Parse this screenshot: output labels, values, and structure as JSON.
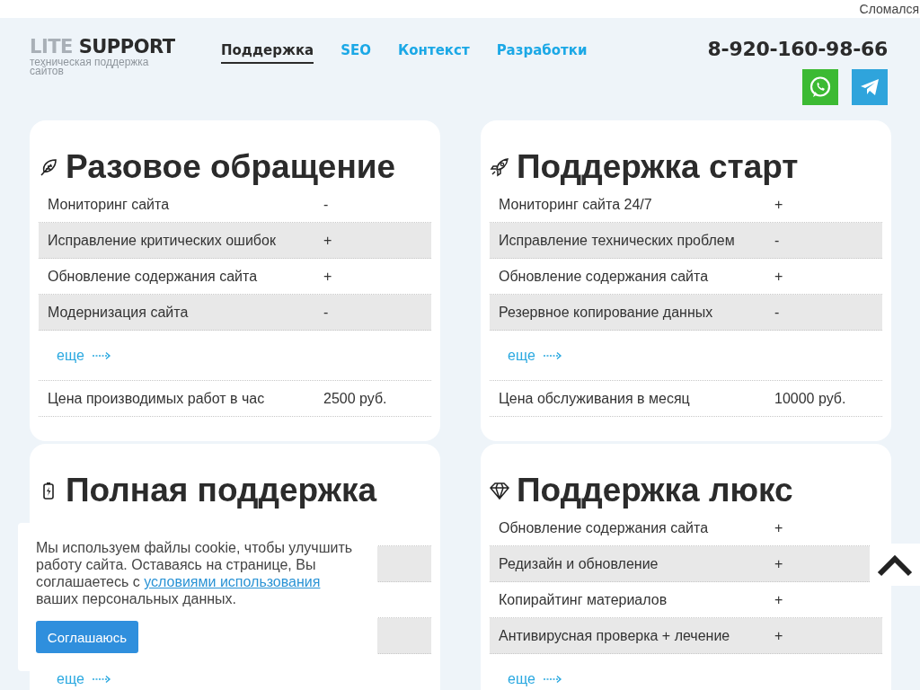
{
  "top_bar": {
    "link": "Сломался"
  },
  "logo": {
    "light": "LITE",
    "dark": "SUPPORT",
    "tagline": "техническая поддержка сайтов"
  },
  "nav": [
    {
      "label": "Поддержка",
      "selected": true
    },
    {
      "label": "SEO",
      "selected": false
    },
    {
      "label": "Контекст",
      "selected": false
    },
    {
      "label": "Разработки",
      "selected": false
    }
  ],
  "phone": "8-920-160-98-66",
  "cards": [
    {
      "title": "Разовое обращение",
      "rows": [
        {
          "label": "Мониторинг сайта",
          "value": "-"
        },
        {
          "label": "Исправление критических ошибок",
          "value": "+"
        },
        {
          "label": "Обновление содержания сайта",
          "value": "+"
        },
        {
          "label": "Модернизация сайта",
          "value": "-"
        }
      ],
      "more": "еще",
      "price": {
        "label": "Цена производимых работ в час",
        "value": "2500 руб."
      }
    },
    {
      "title": "Поддержка старт",
      "rows": [
        {
          "label": "Мониторинг сайта 24/7",
          "value": "+"
        },
        {
          "label": "Исправление технических проблем",
          "value": "-"
        },
        {
          "label": "Обновление содержания сайта",
          "value": "+"
        },
        {
          "label": "Резервное копирование данных",
          "value": "-"
        }
      ],
      "more": "еще",
      "price": {
        "label": "Цена обслуживания в месяц",
        "value": "10000 руб."
      }
    },
    {
      "title": "Полная поддержка",
      "more": "еще"
    },
    {
      "title": "Поддержка люкс",
      "rows": [
        {
          "label": "Обновление содержания сайта",
          "value": "+"
        },
        {
          "label": "Редизайн и обновление",
          "value": "+"
        },
        {
          "label": "Копирайтинг материалов",
          "value": "+"
        },
        {
          "label": "Антивирусная проверка + лечение",
          "value": "+"
        }
      ],
      "more": "еще"
    }
  ],
  "cookie_banner": {
    "text_before": "Мы используем файлы cookie, чтобы улучшить работу сайта. Оставаясь на странице, Вы соглашаетесь с",
    "link": "условиями использования",
    "text_after": "ваших персональных данных.",
    "button": "Соглашаюсь"
  }
}
